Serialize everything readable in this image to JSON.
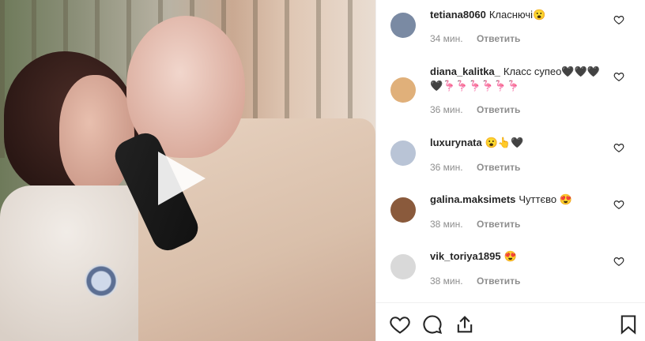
{
  "video": {
    "play_icon": "play-icon"
  },
  "comments": [
    {
      "username": "tetiana8060",
      "text": "Класнючі😮",
      "time": "34 мин.",
      "reply": "Ответить",
      "avatar_color": "#7a8aa3"
    },
    {
      "username": "diana_kalitka_",
      "text": "Класс супео🖤🖤🖤🖤🦩🦩🦩🦩🦩🦩",
      "time": "36 мин.",
      "reply": "Ответить",
      "avatar_color": "#e0b07a"
    },
    {
      "username": "luxurynata",
      "text": "😮👆🖤",
      "time": "36 мин.",
      "reply": "Ответить",
      "avatar_color": "#b9c4d6"
    },
    {
      "username": "galina.maksimets",
      "text": "Чуттєво 😍",
      "time": "38 мин.",
      "reply": "Ответить",
      "avatar_color": "#8a5a3c"
    },
    {
      "username": "vik_toriya1895",
      "text": "😍",
      "time": "38 мин.",
      "reply": "Ответить",
      "avatar_color": "#d9d9d9"
    }
  ],
  "actions": {
    "like_icon": "heart-icon",
    "comment_icon": "comment-icon",
    "share_icon": "share-icon",
    "save_icon": "bookmark-icon"
  }
}
